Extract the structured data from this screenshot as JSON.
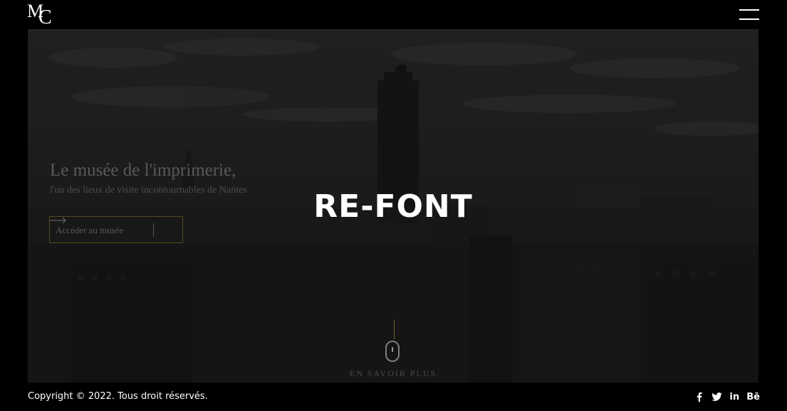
{
  "header": {
    "logo_letters": {
      "first": "M",
      "second": "C"
    },
    "menu_icon": "hamburger-icon"
  },
  "hero": {
    "title": "Le musée de l'imprimerie,",
    "subtitle": "l'un des lieux de visite incontournables de Nantes",
    "cta_label": "Accéder au musée",
    "cta_icon": "arrow-right-icon",
    "brand": "RE-FONT",
    "scroll_icon": "mouse-scroll-icon",
    "scroll_label": "EN SAVOIR PLUS"
  },
  "footer": {
    "copyright": "Copyright © 2022. Tous droit réservés.",
    "social": [
      {
        "name": "facebook-icon",
        "glyph": "f"
      },
      {
        "name": "twitter-icon",
        "glyph": "t"
      },
      {
        "name": "linkedin-icon",
        "glyph": "in"
      },
      {
        "name": "behance-icon",
        "glyph": "Bē"
      }
    ]
  },
  "colors": {
    "background": "#000000",
    "accent_gold": "#6b5d23",
    "text": "#ffffff"
  }
}
